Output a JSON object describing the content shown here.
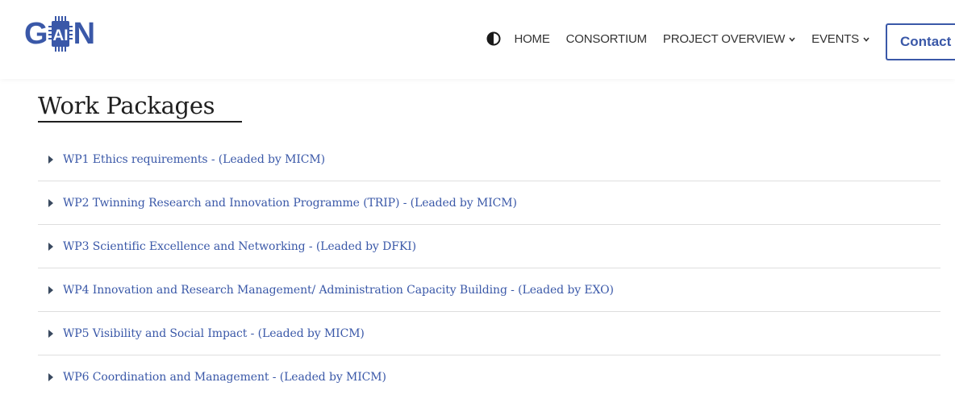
{
  "logo": {
    "letters_left": "G",
    "letter_chip": "AI",
    "letters_right": "N"
  },
  "nav": {
    "contrast_icon": "contrast-icon",
    "items": [
      {
        "label": "HOME"
      },
      {
        "label": "CONSORTIUM"
      },
      {
        "label": "PROJECT OVERVIEW"
      },
      {
        "label": "EVENTS"
      }
    ],
    "contact_label": "Contact"
  },
  "main": {
    "title": "Work Packages",
    "work_packages": [
      {
        "label": "WP1 Ethics requirements - (Leaded by MICM)"
      },
      {
        "label": "WP2 Twinning Research and Innovation Programme (TRIP) - (Leaded by MICM)"
      },
      {
        "label": "WP3 Scientific Excellence and Networking - (Leaded by DFKI)"
      },
      {
        "label": "WP4 Innovation and Research Management/ Administration Capacity Building - (Leaded by EXO)"
      },
      {
        "label": "WP5 Visibility and Social Impact - (Leaded by MICM)"
      },
      {
        "label": "WP6 Coordination and Management - (Leaded by MICM)"
      }
    ]
  },
  "colors": {
    "brand": "#3a58a8",
    "text": "#333333",
    "divider": "#dedede"
  }
}
